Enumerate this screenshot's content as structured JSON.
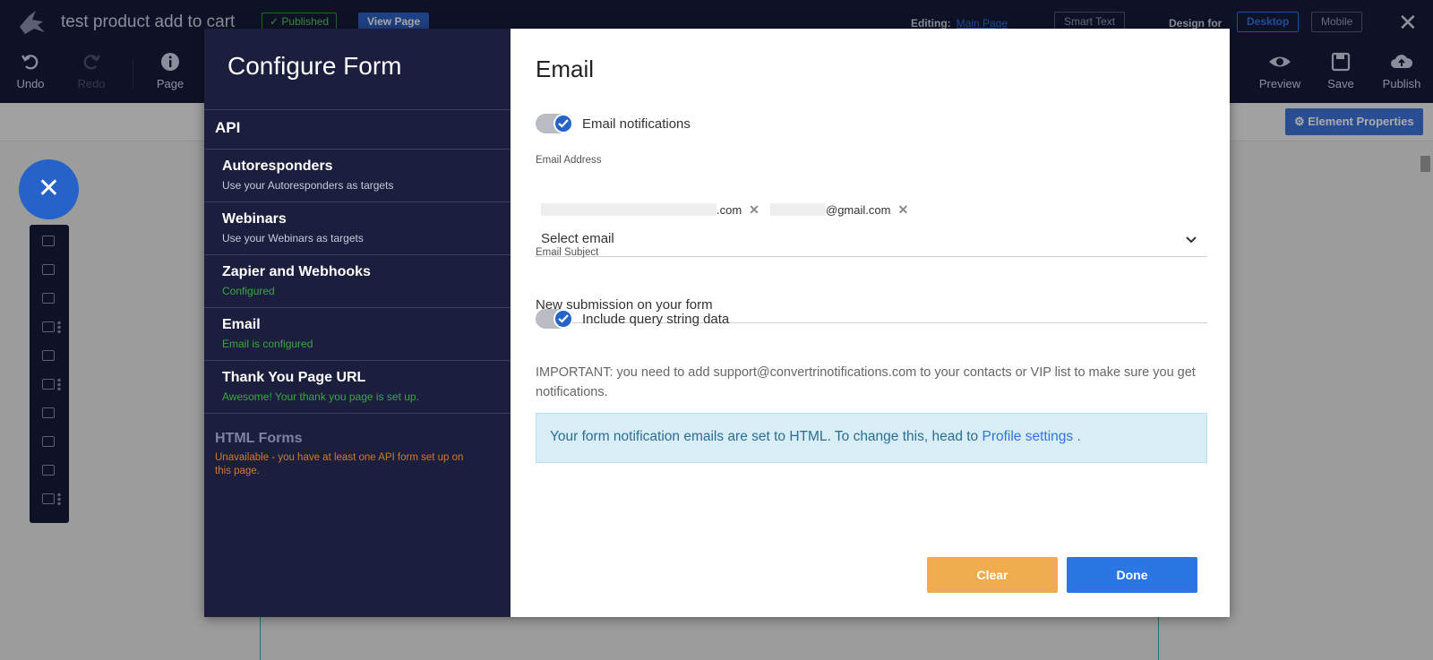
{
  "editor": {
    "page_name": "test product add to cart",
    "published_badge": "✓ Published",
    "view_page": "View Page",
    "editing_label": "Editing:",
    "editing_page": "Main Page",
    "smart_text": "Smart Text",
    "design_for": "Design for",
    "desktop": "Desktop",
    "mobile": "Mobile",
    "close": "✕",
    "toolbar": {
      "undo": "Undo",
      "redo": "Redo",
      "page": "Page",
      "preview": "Preview",
      "save": "Save",
      "publish": "Publish"
    },
    "element_properties": "⚙ Element Properties",
    "fab_close": "✕"
  },
  "modal": {
    "title": "Configure Form",
    "nav": {
      "api": "API",
      "items": [
        {
          "title": "Autoresponders",
          "subtitle": "Use your Autoresponders as targets",
          "status": "neutral"
        },
        {
          "title": "Webinars",
          "subtitle": "Use your Webinars as targets",
          "status": "neutral"
        },
        {
          "title": "Zapier and Webhooks",
          "subtitle": "Configured",
          "status": "ok"
        },
        {
          "title": "Email",
          "subtitle": "Email is configured",
          "status": "ok"
        },
        {
          "title": "Thank You Page URL",
          "subtitle": "Awesome! Your thank you page is set up.",
          "status": "ok"
        }
      ],
      "disabled": {
        "title": "HTML Forms",
        "subtitle": "Unavailable - you have at least one API form set up on this page."
      }
    },
    "content": {
      "heading": "Email",
      "email_notifications_label": "Email notifications",
      "email_notifications_on": true,
      "email_address_label": "Email Address",
      "chips": [
        {
          "suffix": ".com",
          "remove": "✕"
        },
        {
          "suffix": "@gmail.com",
          "remove": "✕"
        }
      ],
      "select_placeholder": "Select email",
      "subject_label": "Email Subject",
      "subject_value": "New submission on your form",
      "query_string_label": "Include query string data",
      "query_string_on": true,
      "important_note": "IMPORTANT: you need to add support@convertrinotifications.com to your contacts or VIP list to make sure you get notifications.",
      "alert_text": "Your form notification emails are set to HTML. To change this, head to ",
      "alert_link": "Profile settings",
      "alert_tail": " .",
      "clear_button": "Clear",
      "done_button": "Done"
    }
  },
  "colors": {
    "topbar": "#171b3a",
    "sidebar": "#1b1e3d",
    "accent": "#2563c9",
    "success": "#3aa83f",
    "warning": "#efac4e",
    "done": "#2b76e5"
  }
}
